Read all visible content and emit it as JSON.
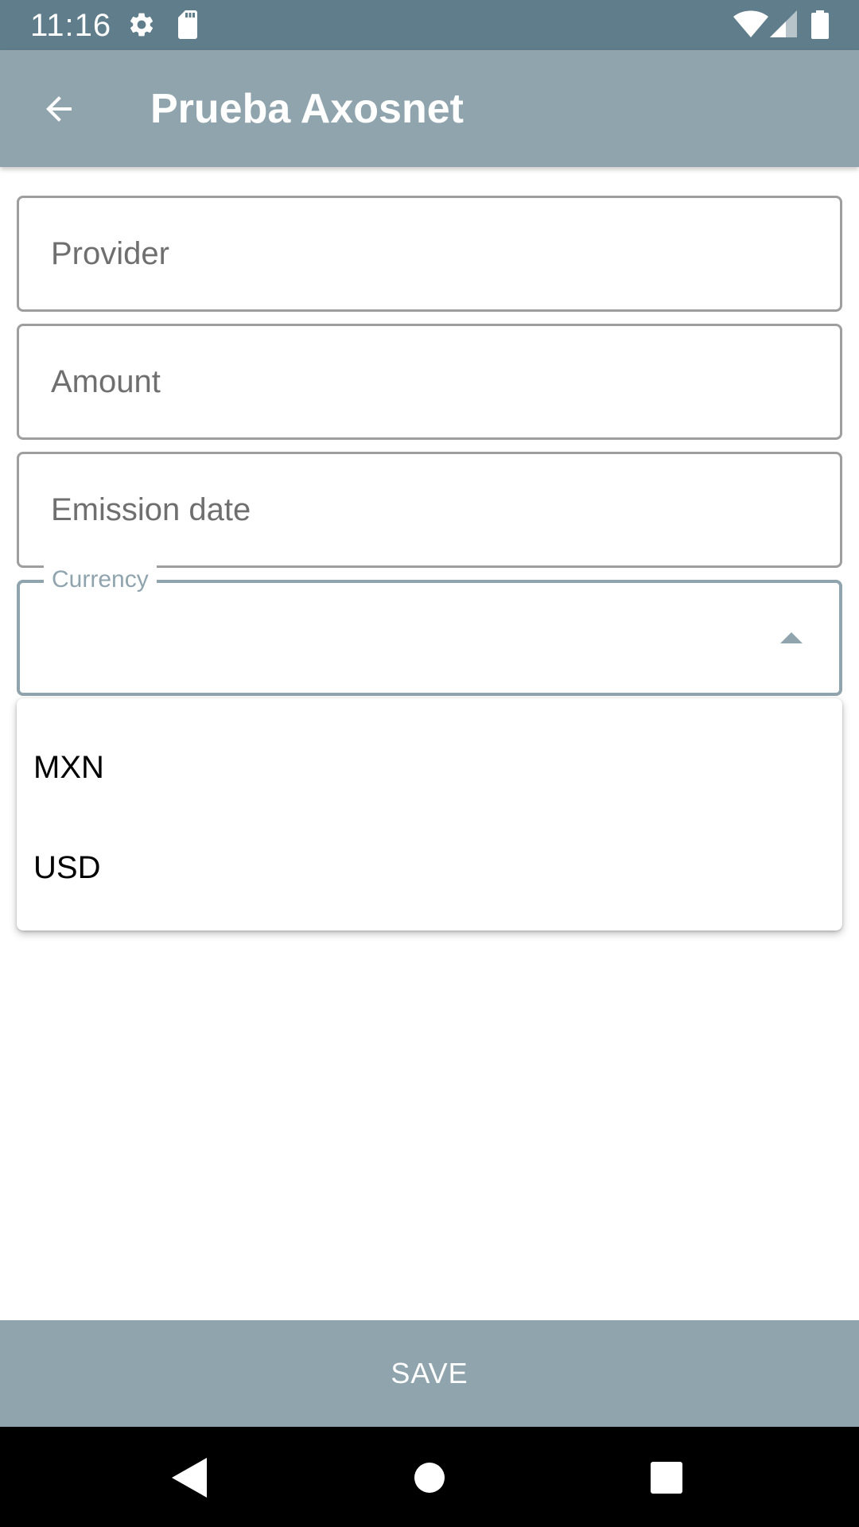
{
  "status_bar": {
    "time": "11:16",
    "icons": [
      "settings-icon",
      "sd-card-icon",
      "wifi-icon",
      "signal-icon",
      "battery-icon"
    ]
  },
  "app_bar": {
    "title": "Prueba Axosnet",
    "back_icon": "arrow-back-icon"
  },
  "form": {
    "provider": {
      "placeholder": "Provider",
      "value": ""
    },
    "amount": {
      "placeholder": "Amount",
      "value": ""
    },
    "emission_date": {
      "placeholder": "Emission date",
      "value": ""
    },
    "currency": {
      "label": "Currency",
      "value": "",
      "expanded": true,
      "options": [
        "MXN",
        "USD"
      ]
    }
  },
  "save_button": {
    "label": "SAVE"
  },
  "nav_bar": {
    "icons": [
      "nav-back-icon",
      "nav-home-icon",
      "nav-recents-icon"
    ]
  },
  "colors": {
    "status_bar": "#607d8b",
    "app_bar": "#90a4ae",
    "accent": "#90a4ae",
    "field_border": "#9e9e9e",
    "placeholder_text": "#6f6f6f"
  }
}
